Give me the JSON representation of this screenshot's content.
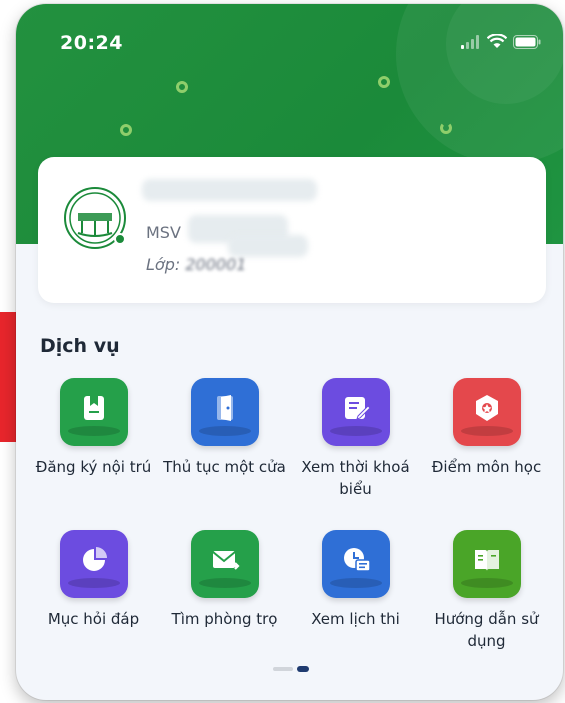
{
  "statusbar": {
    "time": "20:24"
  },
  "profile": {
    "msv_label": "MSV",
    "class_label": "Lớp",
    "class_value": "200001"
  },
  "services": {
    "title": "Dịch vụ",
    "items": [
      {
        "label": "Đăng ký nội trú",
        "icon": "dorm-register-icon",
        "color": "#25a04a"
      },
      {
        "label": "Thủ tục một cửa",
        "icon": "door-icon",
        "color": "#2f6fd6"
      },
      {
        "label": "Xem thời khoá biểu",
        "icon": "timetable-icon",
        "color": "#6c4ce0"
      },
      {
        "label": "Điểm môn học",
        "icon": "grade-icon",
        "color": "#e4484c"
      },
      {
        "label": "Mục hỏi đáp",
        "icon": "qa-chart-icon",
        "color": "#6c4ce0"
      },
      {
        "label": "Tìm phòng trọ",
        "icon": "room-search-icon",
        "color": "#25a04a"
      },
      {
        "label": "Xem lịch thi",
        "icon": "exam-schedule-icon",
        "color": "#2f6fd6"
      },
      {
        "label": "Hướng dẫn sử dụng",
        "icon": "guide-book-icon",
        "color": "#4aa528"
      }
    ]
  },
  "colors": {
    "brand_green": "#1b8a3a",
    "background": "#f3f6fb"
  }
}
